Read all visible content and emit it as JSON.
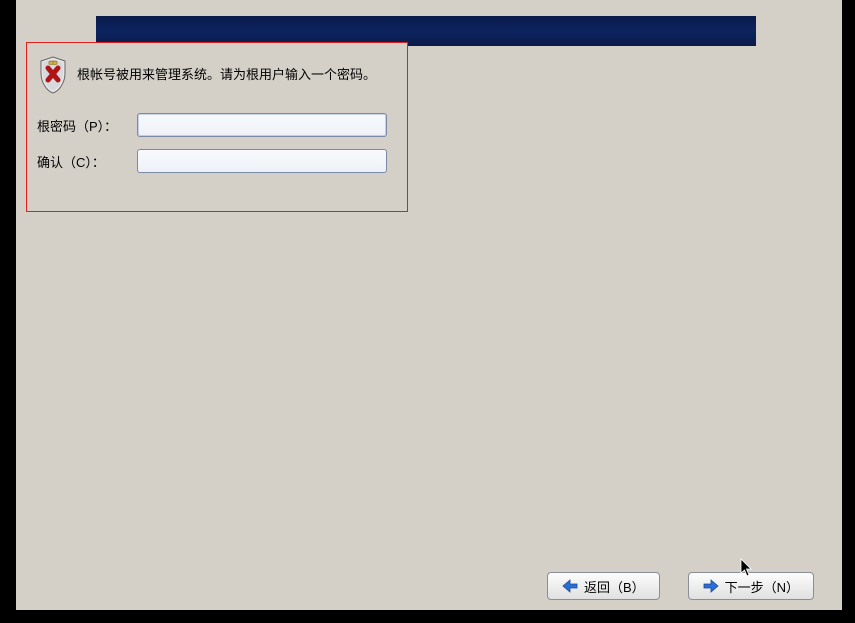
{
  "info": {
    "text": "根帐号被用来管理系统。请为根用户输入一个密码。"
  },
  "fields": {
    "password": {
      "label": "根密码（P）：",
      "value": ""
    },
    "confirm": {
      "label": "确认（C）：",
      "value": ""
    }
  },
  "buttons": {
    "back": "返回（B）",
    "next": "下一步（N）"
  },
  "icons": {
    "shield": "shield-icon",
    "back_arrow": "arrow-left-icon",
    "next_arrow": "arrow-right-icon"
  },
  "colors": {
    "panel_border": "#e02020",
    "header_gradient": "#0d2460",
    "arrow_blue": "#2a6fd6"
  }
}
